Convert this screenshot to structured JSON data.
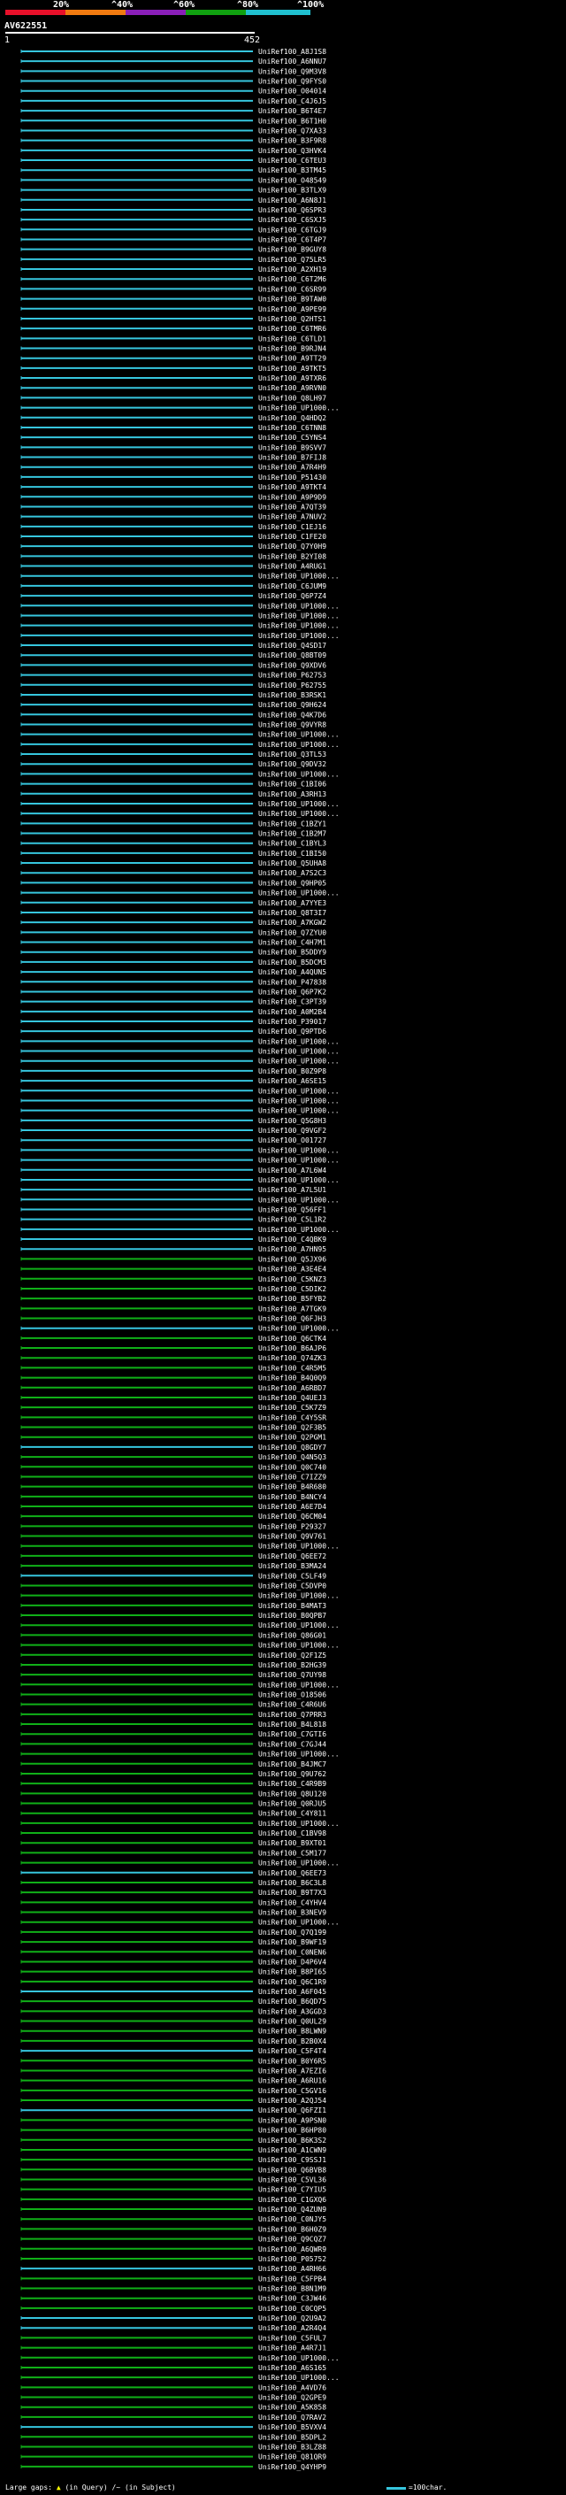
{
  "scale": {
    "labels": [
      "20%",
      "^40%",
      "^60%",
      "^80%",
      "^100%"
    ],
    "colors": [
      "#e8102a",
      "#f07a10",
      "#8a1fb8",
      "#10a010",
      "#20c0d0"
    ]
  },
  "query": {
    "id": "AV622551",
    "start": "1",
    "end": "452"
  },
  "colors": {
    "cyan": "#36c6de",
    "green": "#10b018",
    "white": "#ffffff",
    "background": "#000000"
  },
  "hits": [
    {
      "label": "UniRef100_A8J1S8",
      "color": "cyan"
    },
    {
      "label": "UniRef100_A6NNU7",
      "color": "cyan"
    },
    {
      "label": "UniRef100_Q9M3V8",
      "color": "cyan"
    },
    {
      "label": "UniRef100_Q9FYS0",
      "color": "cyan"
    },
    {
      "label": "UniRef100_O04014",
      "color": "cyan"
    },
    {
      "label": "UniRef100_C4J6J5",
      "color": "cyan"
    },
    {
      "label": "UniRef100_B6T4E7",
      "color": "cyan"
    },
    {
      "label": "UniRef100_B6T1H0",
      "color": "cyan"
    },
    {
      "label": "UniRef100_Q7XA33",
      "color": "cyan"
    },
    {
      "label": "UniRef100_B3F9R8",
      "color": "cyan"
    },
    {
      "label": "UniRef100_Q3HVK4",
      "color": "cyan"
    },
    {
      "label": "UniRef100_C6TEU3",
      "color": "cyan"
    },
    {
      "label": "UniRef100_B3TM45",
      "color": "cyan"
    },
    {
      "label": "UniRef100_O48549",
      "color": "cyan"
    },
    {
      "label": "UniRef100_B3TLX9",
      "color": "cyan"
    },
    {
      "label": "UniRef100_A6N8J1",
      "color": "cyan"
    },
    {
      "label": "UniRef100_Q6SPR3",
      "color": "cyan"
    },
    {
      "label": "UniRef100_C6SXJ5",
      "color": "cyan"
    },
    {
      "label": "UniRef100_C6TGJ9",
      "color": "cyan"
    },
    {
      "label": "UniRef100_C6T4P7",
      "color": "cyan"
    },
    {
      "label": "UniRef100_B9GUY8",
      "color": "cyan"
    },
    {
      "label": "UniRef100_Q75LR5",
      "color": "cyan"
    },
    {
      "label": "UniRef100_A2XH19",
      "color": "cyan"
    },
    {
      "label": "UniRef100_C6T2M6",
      "color": "cyan"
    },
    {
      "label": "UniRef100_C6SR99",
      "color": "cyan"
    },
    {
      "label": "UniRef100_B9TAW0",
      "color": "cyan"
    },
    {
      "label": "UniRef100_A9PE99",
      "color": "cyan"
    },
    {
      "label": "UniRef100_Q2HTS1",
      "color": "cyan"
    },
    {
      "label": "UniRef100_C6TMR6",
      "color": "cyan"
    },
    {
      "label": "UniRef100_C6TLD1",
      "color": "cyan"
    },
    {
      "label": "UniRef100_B9RJN4",
      "color": "cyan"
    },
    {
      "label": "UniRef100_A9TT29",
      "color": "cyan"
    },
    {
      "label": "UniRef100_A9TKT5",
      "color": "cyan"
    },
    {
      "label": "UniRef100_A9TXR6",
      "color": "cyan"
    },
    {
      "label": "UniRef100_A9RVN0",
      "color": "cyan"
    },
    {
      "label": "UniRef100_Q8LH97",
      "color": "cyan"
    },
    {
      "label": "UniRef100_UP1000...",
      "color": "cyan"
    },
    {
      "label": "UniRef100_Q4HDQ2",
      "color": "cyan"
    },
    {
      "label": "UniRef100_C6TNN8",
      "color": "cyan"
    },
    {
      "label": "UniRef100_C5YNS4",
      "color": "cyan"
    },
    {
      "label": "UniRef100_B9SVV7",
      "color": "cyan"
    },
    {
      "label": "UniRef100_B7FIJ8",
      "color": "cyan"
    },
    {
      "label": "UniRef100_A7R4H9",
      "color": "cyan"
    },
    {
      "label": "UniRef100_P51430",
      "color": "cyan"
    },
    {
      "label": "UniRef100_A9TKT4",
      "color": "cyan"
    },
    {
      "label": "UniRef100_A9P9D9",
      "color": "cyan"
    },
    {
      "label": "UniRef100_A7QT39",
      "color": "cyan"
    },
    {
      "label": "UniRef100_A7NUV2",
      "color": "cyan"
    },
    {
      "label": "UniRef100_C1EJ16",
      "color": "cyan"
    },
    {
      "label": "UniRef100_C1FE20",
      "color": "cyan"
    },
    {
      "label": "UniRef100_Q7Y0H9",
      "color": "cyan"
    },
    {
      "label": "UniRef100_B2YI08",
      "color": "cyan"
    },
    {
      "label": "UniRef100_A4RUG1",
      "color": "cyan"
    },
    {
      "label": "UniRef100_UP1000...",
      "color": "cyan"
    },
    {
      "label": "UniRef100_C6JUM9",
      "color": "cyan"
    },
    {
      "label": "UniRef100_Q6P7Z4",
      "color": "cyan"
    },
    {
      "label": "UniRef100_UP1000...",
      "color": "cyan"
    },
    {
      "label": "UniRef100_UP1000...",
      "color": "cyan"
    },
    {
      "label": "UniRef100_UP1000...",
      "color": "cyan"
    },
    {
      "label": "UniRef100_UP1000...",
      "color": "cyan"
    },
    {
      "label": "UniRef100_Q4SD17",
      "color": "cyan"
    },
    {
      "label": "UniRef100_Q8BT09",
      "color": "cyan"
    },
    {
      "label": "UniRef100_Q9XDV6",
      "color": "cyan"
    },
    {
      "label": "UniRef100_P62753",
      "color": "cyan"
    },
    {
      "label": "UniRef100_P62755",
      "color": "cyan"
    },
    {
      "label": "UniRef100_B3RSK1",
      "color": "cyan"
    },
    {
      "label": "UniRef100_Q9H624",
      "color": "cyan"
    },
    {
      "label": "UniRef100_Q4K7D6",
      "color": "cyan"
    },
    {
      "label": "UniRef100_Q9VYR8",
      "color": "cyan"
    },
    {
      "label": "UniRef100_UP1000...",
      "color": "cyan"
    },
    {
      "label": "UniRef100_UP1000...",
      "color": "cyan"
    },
    {
      "label": "UniRef100_Q3TL53",
      "color": "cyan"
    },
    {
      "label": "UniRef100_Q9DV32",
      "color": "cyan"
    },
    {
      "label": "UniRef100_UP1000...",
      "color": "cyan"
    },
    {
      "label": "UniRef100_C1BI06",
      "color": "cyan"
    },
    {
      "label": "UniRef100_A3RH13",
      "color": "cyan"
    },
    {
      "label": "UniRef100_UP1000...",
      "color": "cyan"
    },
    {
      "label": "UniRef100_UP1000...",
      "color": "cyan"
    },
    {
      "label": "UniRef100_C1BZY1",
      "color": "cyan"
    },
    {
      "label": "UniRef100_C1B2M7",
      "color": "cyan"
    },
    {
      "label": "UniRef100_C1BYL3",
      "color": "cyan"
    },
    {
      "label": "UniRef100_C1BI50",
      "color": "cyan"
    },
    {
      "label": "UniRef100_Q5UHA8",
      "color": "cyan"
    },
    {
      "label": "UniRef100_A7S2C3",
      "color": "cyan"
    },
    {
      "label": "UniRef100_Q9HP05",
      "color": "cyan"
    },
    {
      "label": "UniRef100_UP1000...",
      "color": "cyan"
    },
    {
      "label": "UniRef100_A7YYE3",
      "color": "cyan"
    },
    {
      "label": "UniRef100_Q8T3I7",
      "color": "cyan"
    },
    {
      "label": "UniRef100_A7KGW2",
      "color": "cyan"
    },
    {
      "label": "UniRef100_Q7ZYU0",
      "color": "cyan"
    },
    {
      "label": "UniRef100_C4H7M1",
      "color": "cyan"
    },
    {
      "label": "UniRef100_B5DDY9",
      "color": "cyan"
    },
    {
      "label": "UniRef100_B5DCM3",
      "color": "cyan"
    },
    {
      "label": "UniRef100_A4QUN5",
      "color": "cyan"
    },
    {
      "label": "UniRef100_P47838",
      "color": "cyan"
    },
    {
      "label": "UniRef100_Q6P7K2",
      "color": "cyan"
    },
    {
      "label": "UniRef100_C3PT39",
      "color": "cyan"
    },
    {
      "label": "UniRef100_A0M2B4",
      "color": "cyan"
    },
    {
      "label": "UniRef100_P39017",
      "color": "cyan"
    },
    {
      "label": "UniRef100_Q9PTD6",
      "color": "cyan"
    },
    {
      "label": "UniRef100_UP1000...",
      "color": "cyan"
    },
    {
      "label": "UniRef100_UP1000...",
      "color": "cyan"
    },
    {
      "label": "UniRef100_UP1000...",
      "color": "cyan"
    },
    {
      "label": "UniRef100_B0Z9P8",
      "color": "cyan"
    },
    {
      "label": "UniRef100_A6SE15",
      "color": "cyan"
    },
    {
      "label": "UniRef100_UP1000...",
      "color": "cyan"
    },
    {
      "label": "UniRef100_UP1000...",
      "color": "cyan"
    },
    {
      "label": "UniRef100_UP1000...",
      "color": "cyan"
    },
    {
      "label": "UniRef100_Q5G8H3",
      "color": "cyan"
    },
    {
      "label": "UniRef100_Q9VGF2",
      "color": "cyan"
    },
    {
      "label": "UniRef100_O01727",
      "color": "cyan"
    },
    {
      "label": "UniRef100_UP1000...",
      "color": "cyan"
    },
    {
      "label": "UniRef100_UP1000...",
      "color": "cyan"
    },
    {
      "label": "UniRef100_A7L6W4",
      "color": "cyan"
    },
    {
      "label": "UniRef100_UP1000...",
      "color": "cyan"
    },
    {
      "label": "UniRef100_A7L5U1",
      "color": "cyan"
    },
    {
      "label": "UniRef100_UP1000...",
      "color": "cyan"
    },
    {
      "label": "UniRef100_Q56FF1",
      "color": "cyan"
    },
    {
      "label": "UniRef100_C5L1R2",
      "color": "cyan"
    },
    {
      "label": "UniRef100_UP1000...",
      "color": "cyan"
    },
    {
      "label": "UniRef100_C4QBK9",
      "color": "cyan"
    },
    {
      "label": "UniRef100_A7HN95",
      "color": "cyan"
    },
    {
      "label": "UniRef100_Q5JX96",
      "color": "green"
    },
    {
      "label": "UniRef100_A3E4E4",
      "color": "green"
    },
    {
      "label": "UniRef100_C5KNZ3",
      "color": "green"
    },
    {
      "label": "UniRef100_C5DIK2",
      "color": "green"
    },
    {
      "label": "UniRef100_B5FYB2",
      "color": "green"
    },
    {
      "label": "UniRef100_A7TGK9",
      "color": "green"
    },
    {
      "label": "UniRef100_Q6FJH3",
      "color": "green"
    },
    {
      "label": "UniRef100_UP1000...",
      "color": "cyan"
    },
    {
      "label": "UniRef100_Q6CTK4",
      "color": "green"
    },
    {
      "label": "UniRef100_B6AJP6",
      "color": "green"
    },
    {
      "label": "UniRef100_Q74ZK3",
      "color": "green"
    },
    {
      "label": "UniRef100_C4R5M5",
      "color": "green"
    },
    {
      "label": "UniRef100_B4Q0Q9",
      "color": "green"
    },
    {
      "label": "UniRef100_A6RBD7",
      "color": "green"
    },
    {
      "label": "UniRef100_Q4UEJ3",
      "color": "green"
    },
    {
      "label": "UniRef100_C5K7Z9",
      "color": "green"
    },
    {
      "label": "UniRef100_C4Y5SR",
      "color": "green"
    },
    {
      "label": "UniRef100_Q2F3B5",
      "color": "green"
    },
    {
      "label": "UniRef100_Q2PGM1",
      "color": "green"
    },
    {
      "label": "UniRef100_Q8GDY7",
      "color": "cyan"
    },
    {
      "label": "UniRef100_Q4N5Q3",
      "color": "green"
    },
    {
      "label": "UniRef100_Q0C740",
      "color": "green"
    },
    {
      "label": "UniRef100_C7IZZ9",
      "color": "green"
    },
    {
      "label": "UniRef100_B4R680",
      "color": "green"
    },
    {
      "label": "UniRef100_B4NCY4",
      "color": "green"
    },
    {
      "label": "UniRef100_A6E7D4",
      "color": "green"
    },
    {
      "label": "UniRef100_Q6CM04",
      "color": "green"
    },
    {
      "label": "UniRef100_P29327",
      "color": "green"
    },
    {
      "label": "UniRef100_Q9V761",
      "color": "green"
    },
    {
      "label": "UniRef100_UP1000...",
      "color": "green"
    },
    {
      "label": "UniRef100_Q6EE72",
      "color": "green"
    },
    {
      "label": "UniRef100_B3MA24",
      "color": "green"
    },
    {
      "label": "UniRef100_C5LF49",
      "color": "cyan"
    },
    {
      "label": "UniRef100_C5DVP0",
      "color": "green"
    },
    {
      "label": "UniRef100_UP1000...",
      "color": "green"
    },
    {
      "label": "UniRef100_B4MAT3",
      "color": "green"
    },
    {
      "label": "UniRef100_B0QPB7",
      "color": "green"
    },
    {
      "label": "UniRef100_UP1000...",
      "color": "green"
    },
    {
      "label": "UniRef100_Q86G01",
      "color": "green"
    },
    {
      "label": "UniRef100_UP1000...",
      "color": "green"
    },
    {
      "label": "UniRef100_Q2F1Z5",
      "color": "green"
    },
    {
      "label": "UniRef100_B2HG39",
      "color": "green"
    },
    {
      "label": "UniRef100_Q7UY98",
      "color": "green"
    },
    {
      "label": "UniRef100_UP1000...",
      "color": "green"
    },
    {
      "label": "UniRef100_O18506",
      "color": "green"
    },
    {
      "label": "UniRef100_C4R6U6",
      "color": "green"
    },
    {
      "label": "UniRef100_Q7PRR3",
      "color": "green"
    },
    {
      "label": "UniRef100_B4L818",
      "color": "green"
    },
    {
      "label": "UniRef100_C7GTI6",
      "color": "green"
    },
    {
      "label": "UniRef100_C7GJ44",
      "color": "green"
    },
    {
      "label": "UniRef100_UP1000...",
      "color": "green"
    },
    {
      "label": "UniRef100_B4JMC7",
      "color": "green"
    },
    {
      "label": "UniRef100_Q9U762",
      "color": "green"
    },
    {
      "label": "UniRef100_C4R9B9",
      "color": "green"
    },
    {
      "label": "UniRef100_Q8U120",
      "color": "green"
    },
    {
      "label": "UniRef100_Q0RJU5",
      "color": "green"
    },
    {
      "label": "UniRef100_C4Y811",
      "color": "green"
    },
    {
      "label": "UniRef100_UP1000...",
      "color": "green"
    },
    {
      "label": "UniRef100_C1BV98",
      "color": "green"
    },
    {
      "label": "UniRef100_B9XT01",
      "color": "green"
    },
    {
      "label": "UniRef100_C5M177",
      "color": "green"
    },
    {
      "label": "UniRef100_UP1000...",
      "color": "green"
    },
    {
      "label": "UniRef100_Q6EE73",
      "color": "cyan"
    },
    {
      "label": "UniRef100_B6C3L8",
      "color": "green"
    },
    {
      "label": "UniRef100_B9T7X3",
      "color": "green"
    },
    {
      "label": "UniRef100_C4YHV4",
      "color": "green"
    },
    {
      "label": "UniRef100_B3NEV9",
      "color": "green"
    },
    {
      "label": "UniRef100_UP1000...",
      "color": "green"
    },
    {
      "label": "UniRef100_Q7Q199",
      "color": "green"
    },
    {
      "label": "UniRef100_B9WF19",
      "color": "green"
    },
    {
      "label": "UniRef100_C0NEN6",
      "color": "green"
    },
    {
      "label": "UniRef100_D4P6V4",
      "color": "green"
    },
    {
      "label": "UniRef100_B8PI65",
      "color": "green"
    },
    {
      "label": "UniRef100_Q6C1R9",
      "color": "green"
    },
    {
      "label": "UniRef100_A6F045",
      "color": "cyan"
    },
    {
      "label": "UniRef100_B6QD75",
      "color": "green"
    },
    {
      "label": "UniRef100_A3GGD3",
      "color": "green"
    },
    {
      "label": "UniRef100_Q0UL29",
      "color": "green"
    },
    {
      "label": "UniRef100_B8LWN9",
      "color": "green"
    },
    {
      "label": "UniRef100_B2B0X4",
      "color": "green"
    },
    {
      "label": "UniRef100_C5F4T4",
      "color": "cyan"
    },
    {
      "label": "UniRef100_B0Y6R5",
      "color": "green"
    },
    {
      "label": "UniRef100_A7EZI6",
      "color": "green"
    },
    {
      "label": "UniRef100_A6RU16",
      "color": "green"
    },
    {
      "label": "UniRef100_C5GV16",
      "color": "green"
    },
    {
      "label": "UniRef100_A2QJ54",
      "color": "green"
    },
    {
      "label": "UniRef100_Q6FZI1",
      "color": "cyan"
    },
    {
      "label": "UniRef100_A9PSN0",
      "color": "green"
    },
    {
      "label": "UniRef100_B6HP80",
      "color": "green"
    },
    {
      "label": "UniRef100_B6K3S2",
      "color": "green"
    },
    {
      "label": "UniRef100_A1CWN9",
      "color": "green"
    },
    {
      "label": "UniRef100_C9SSJ1",
      "color": "green"
    },
    {
      "label": "UniRef100_Q6BVB8",
      "color": "green"
    },
    {
      "label": "UniRef100_C5VL36",
      "color": "green"
    },
    {
      "label": "UniRef100_C7YIU5",
      "color": "green"
    },
    {
      "label": "UniRef100_C1GXQ6",
      "color": "green"
    },
    {
      "label": "UniRef100_Q4ZUN9",
      "color": "green"
    },
    {
      "label": "UniRef100_C0NJY5",
      "color": "green"
    },
    {
      "label": "UniRef100_B6H0Z9",
      "color": "green"
    },
    {
      "label": "UniRef100_Q9CQZ7",
      "color": "green"
    },
    {
      "label": "UniRef100_A6QWR9",
      "color": "green"
    },
    {
      "label": "UniRef100_P05752",
      "color": "green"
    },
    {
      "label": "UniRef100_A4RH66",
      "color": "cyan"
    },
    {
      "label": "UniRef100_C5FPB4",
      "color": "green"
    },
    {
      "label": "UniRef100_B8N1M9",
      "color": "green"
    },
    {
      "label": "UniRef100_C3JW46",
      "color": "green"
    },
    {
      "label": "UniRef100_C0CQP5",
      "color": "green"
    },
    {
      "label": "UniRef100_Q2U9A2",
      "color": "cyan"
    },
    {
      "label": "UniRef100_A2R4Q4",
      "color": "cyan"
    },
    {
      "label": "UniRef100_C5FUL7",
      "color": "green"
    },
    {
      "label": "UniRef100_A4R7J1",
      "color": "green"
    },
    {
      "label": "UniRef100_UP1000...",
      "color": "green"
    },
    {
      "label": "UniRef100_A6S165",
      "color": "green"
    },
    {
      "label": "UniRef100_UP1000...",
      "color": "green"
    },
    {
      "label": "UniRef100_A4VD76",
      "color": "green"
    },
    {
      "label": "UniRef100_Q2GPE9",
      "color": "green"
    },
    {
      "label": "UniRef100_A5K858",
      "color": "green"
    },
    {
      "label": "UniRef100_Q7RAV2",
      "color": "green"
    },
    {
      "label": "UniRef100_B5VXV4",
      "color": "cyan"
    },
    {
      "label": "UniRef100_B5DPL2",
      "color": "green"
    },
    {
      "label": "UniRef100_B3LZ88",
      "color": "green"
    },
    {
      "label": "UniRef100_Q81QR9",
      "color": "green"
    },
    {
      "label": "UniRef100_Q4YHP9",
      "color": "green"
    }
  ],
  "footer": {
    "large_gaps_label": "Large gaps:",
    "query_gap_label": "(in Query)",
    "subject_gap_label": "(in Subject)",
    "char_scale_label": "=100char."
  }
}
